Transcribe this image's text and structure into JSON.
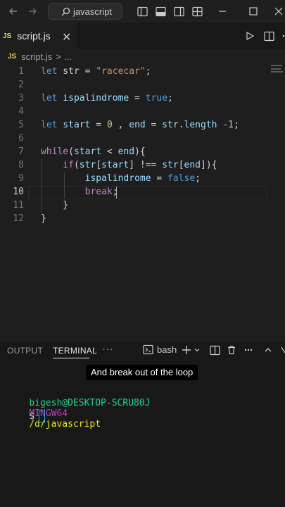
{
  "titlebar": {
    "search_text": "javascript"
  },
  "tab": {
    "badge": "JS",
    "label": "script.js",
    "close": "✕"
  },
  "breadcrumb": {
    "badge": "JS",
    "file": "script.js",
    "sep": ">",
    "more": "..."
  },
  "editor": {
    "active_line": 10,
    "line_numbers": [
      "1",
      "2",
      "3",
      "4",
      "5",
      "6",
      "7",
      "8",
      "9",
      "10",
      "11",
      "12"
    ],
    "lines": [
      [
        [
          "kw",
          "let"
        ],
        [
          "op",
          " str = "
        ],
        [
          "str",
          "\"racecar\""
        ],
        [
          "op",
          ";"
        ]
      ],
      [],
      [
        [
          "kw",
          "let"
        ],
        [
          "op",
          " "
        ],
        [
          "var",
          "ispalindrome"
        ],
        [
          "op",
          " = "
        ],
        [
          "kw",
          "true"
        ],
        [
          "op",
          ";"
        ]
      ],
      [],
      [
        [
          "kw",
          "let"
        ],
        [
          "op",
          " "
        ],
        [
          "var",
          "start"
        ],
        [
          "op",
          " = "
        ],
        [
          "num",
          "0"
        ],
        [
          "op",
          " , "
        ],
        [
          "var",
          "end"
        ],
        [
          "op",
          " = "
        ],
        [
          "var",
          "str"
        ],
        [
          "op",
          "."
        ],
        [
          "prop",
          "length"
        ],
        [
          "op",
          " "
        ],
        [
          "num",
          "-1"
        ],
        [
          "op",
          ";"
        ]
      ],
      [],
      [
        [
          "ctl",
          "while"
        ],
        [
          "op",
          "("
        ],
        [
          "var",
          "start"
        ],
        [
          "op",
          " < "
        ],
        [
          "var",
          "end"
        ],
        [
          "op",
          "){"
        ]
      ],
      [
        [
          "op",
          "    "
        ],
        [
          "ctl",
          "if"
        ],
        [
          "op",
          "("
        ],
        [
          "var",
          "str"
        ],
        [
          "op",
          "["
        ],
        [
          "var",
          "start"
        ],
        [
          "op",
          "] !== "
        ],
        [
          "var",
          "str"
        ],
        [
          "op",
          "["
        ],
        [
          "var",
          "end"
        ],
        [
          "op",
          "]){"
        ]
      ],
      [
        [
          "op",
          "        "
        ],
        [
          "var",
          "ispalindrome"
        ],
        [
          "op",
          " = "
        ],
        [
          "kw",
          "false"
        ],
        [
          "op",
          ";"
        ]
      ],
      [
        [
          "op",
          "        "
        ],
        [
          "ctl",
          "break"
        ],
        [
          "op",
          ";"
        ]
      ],
      [
        [
          "op",
          "    }"
        ]
      ],
      [
        [
          "op",
          "}"
        ]
      ]
    ]
  },
  "panel": {
    "tabs": [
      "OUTPUT",
      "TERMINAL"
    ],
    "more": "···",
    "shell": "bash"
  },
  "terminal": {
    "caption": "And break out of the loop",
    "user": "bigesh@DESKTOP-SCRU80J",
    "env": "MINGW64",
    "path": "/d/javascript",
    "prompt": "$"
  },
  "colors": {
    "background": "#1e1e1e",
    "keyword": "#569cd6",
    "string": "#ce9178",
    "number": "#b5cea8",
    "control": "#c586c0",
    "variable": "#9cdcfe",
    "terminal_user": "#23d18b",
    "terminal_env": "#bc3fbc",
    "terminal_path": "#e5e510",
    "js_badge": "#e8d44d"
  }
}
